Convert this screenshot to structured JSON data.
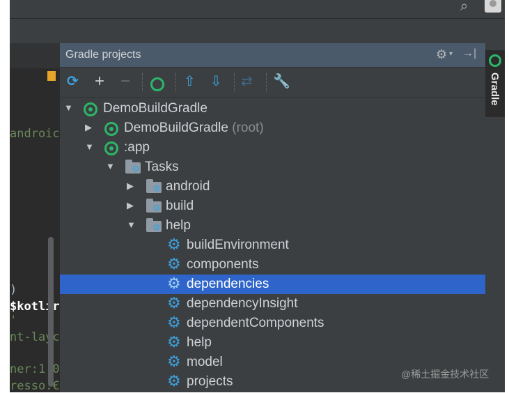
{
  "window": {
    "search_icon": "search-icon",
    "avatar_icon": "user-icon"
  },
  "editor": {
    "lines": [
      {
        "text": "androic",
        "color": "#6a8759"
      },
      {
        "text": ")",
        "color": "#a9b7c6"
      },
      {
        "text": "$kotlir",
        "color": "#ffffff"
      },
      {
        "text": "'",
        "color": "#6a8759"
      },
      {
        "text": "nt-layc",
        "color": "#6a8759"
      },
      {
        "text": "ner:1.0",
        "color": "#6a8759"
      },
      {
        "text": "resso:€",
        "color": "#6a8759"
      }
    ]
  },
  "panel": {
    "title": "Gradle projects",
    "header_icons": [
      "gear-icon",
      "hide-icon"
    ],
    "toolbar": [
      "refresh-icon",
      "add-icon",
      "remove-icon",
      "run-gradle-icon",
      "expand-all-icon",
      "collapse-all-icon",
      "link-icon",
      "settings-wrench-icon"
    ]
  },
  "tree": {
    "root": {
      "label": "DemoBuildGradle",
      "expanded": true
    },
    "root_project": {
      "label": "DemoBuildGradle",
      "suffix": "(root)",
      "expanded": false
    },
    "app": {
      "label": ":app",
      "expanded": true
    },
    "tasks": {
      "label": "Tasks",
      "expanded": true
    },
    "android": {
      "label": "android",
      "expanded": false
    },
    "build": {
      "label": "build",
      "expanded": false
    },
    "help": {
      "label": "help",
      "expanded": true
    },
    "tasks_help": [
      {
        "label": "buildEnvironment",
        "selected": false
      },
      {
        "label": "components",
        "selected": false
      },
      {
        "label": "dependencies",
        "selected": true
      },
      {
        "label": "dependencyInsight",
        "selected": false
      },
      {
        "label": "dependentComponents",
        "selected": false
      },
      {
        "label": "help",
        "selected": false
      },
      {
        "label": "model",
        "selected": false
      },
      {
        "label": "projects",
        "selected": false
      }
    ]
  },
  "side_tab": {
    "label": "Gradle"
  },
  "watermark": "@稀土掘金技术社区",
  "colors": {
    "selection": "#2f65ca",
    "gradle_green": "#2cb66a",
    "task_blue": "#3ea1df"
  }
}
